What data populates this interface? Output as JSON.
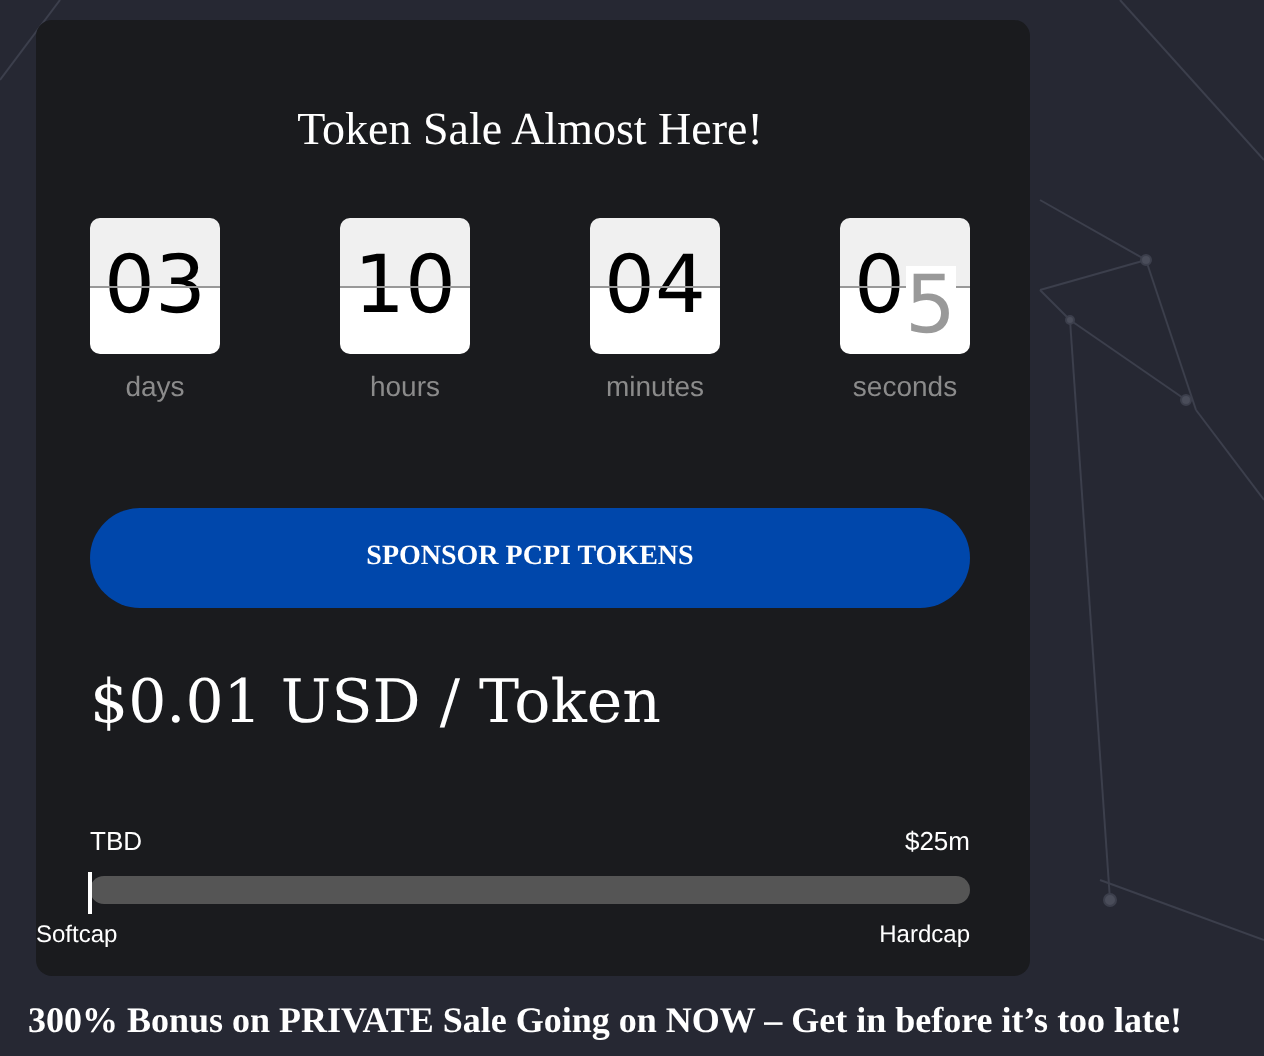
{
  "card": {
    "title": "Token Sale Almost Here!",
    "countdown": [
      {
        "value": "03",
        "label": "days"
      },
      {
        "value": "10",
        "label": "hours"
      },
      {
        "value": "04",
        "label": "minutes"
      },
      {
        "value": "0",
        "incoming": "5",
        "label": "seconds"
      }
    ],
    "button": "SPONSOR PCPI TOKENS",
    "price": "$0.01 USD / Token",
    "progress": {
      "left_value": "TBD",
      "right_value": "$25m",
      "level": 0,
      "left_label": "Softcap",
      "right_label": "Hardcap"
    }
  },
  "banner": "300% Bonus on PRIVATE Sale Going on NOW – Get in before it’s too late!"
}
